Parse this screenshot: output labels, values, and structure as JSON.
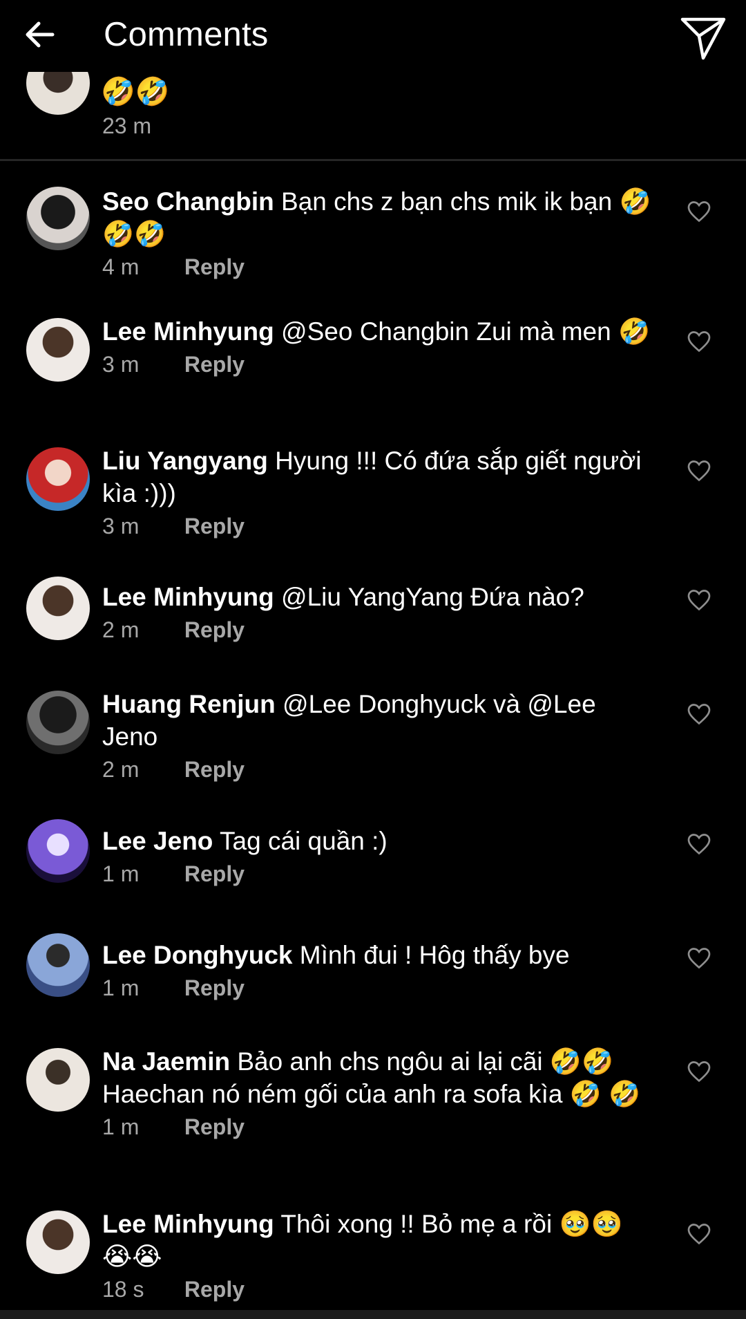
{
  "header": {
    "title": "Comments",
    "back_icon": "arrow-left-icon",
    "send_icon": "paper-plane-icon"
  },
  "partial_comment": {
    "emojis": "🤣🤣",
    "time": "23 m"
  },
  "reply_label": "Reply",
  "comments": [
    {
      "username": "Seo Changbin",
      "text": "Bạn chs z bạn chs mik ik bạn 🤣🤣🤣",
      "time": "4 m"
    },
    {
      "username": "Lee Minhyung",
      "text": "@Seo Changbin Zui mà men 🤣",
      "time": "3 m"
    },
    {
      "username": "Liu Yangyang",
      "text": "Hyung !!! Có đứa sắp giết người kìa :)))",
      "time": "3 m"
    },
    {
      "username": "Lee Minhyung",
      "text": "@Liu YangYang Đứa nào?",
      "time": "2 m"
    },
    {
      "username": "Huang Renjun",
      "text": "@Lee Donghyuck và @Lee Jeno",
      "time": "2 m"
    },
    {
      "username": "Lee Jeno",
      "text": "Tag cái quần :)",
      "time": "1 m"
    },
    {
      "username": "Lee Donghyuck",
      "text": "Mình đui ! Hôg thấy bye",
      "time": "1 m"
    },
    {
      "username": "Na Jaemin",
      "text": "Bảo anh chs ngôu ai lại cãi 🤣🤣 Haechan nó ném gối của anh ra sofa kìa 🤣 🤣",
      "time": "1 m"
    },
    {
      "username": "Lee Minhyung",
      "text": "Thôi xong !! Bỏ mẹ a rồi 🥹🥹 😭😭",
      "time": "18 s"
    }
  ],
  "colors": {
    "background": "#000000",
    "text": "#ffffff",
    "secondary_text": "#a8a8a8",
    "divider": "#262626"
  }
}
